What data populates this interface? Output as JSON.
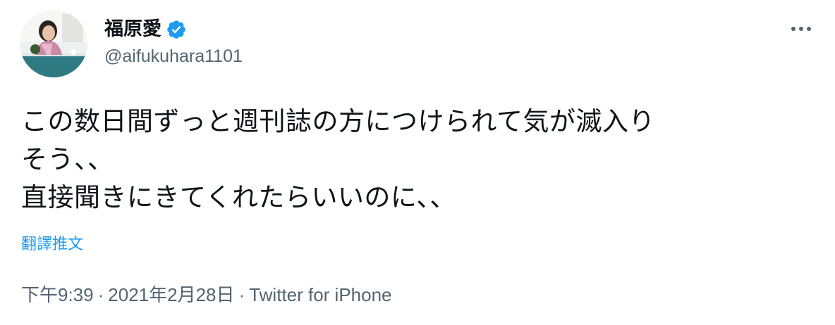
{
  "user": {
    "display_name": "福原愛",
    "handle": "@aifukuhara1101",
    "verified": true,
    "avatar_icon": "profile-photo"
  },
  "more_icon": "more-options-icon",
  "tweet": {
    "text": "この数日間ずっと週刊誌の方につけられて気が滅入り\nそう、、\n直接聞きにきてくれたらいいのに、、"
  },
  "translate_label": "翻譯推文",
  "meta": {
    "time": "下午9:39",
    "separator": "·",
    "date": "2021年2月28日",
    "source": "Twitter for iPhone"
  },
  "colors": {
    "accent": "#1d9bf0",
    "text": "#0f1419",
    "secondary": "#536471"
  }
}
